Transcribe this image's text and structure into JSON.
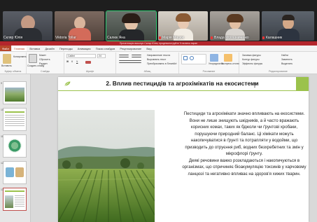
{
  "participants": [
    {
      "name": "Скляр Юлія",
      "muted": false,
      "bg": "#4a4e57"
    },
    {
      "name": "Viktoria Tollar",
      "muted": false,
      "bg": "#6e5a50"
    },
    {
      "name": "Салюк Яна",
      "muted": false,
      "bg": "#58605a",
      "active": true
    },
    {
      "name": "Марія Мацюк",
      "muted": true,
      "bg": "#bfb8ae"
    },
    {
      "name": "Влада Мірошниченко",
      "muted": true,
      "bg": "#8e8a86"
    },
    {
      "name": "Калашник",
      "muted": true,
      "bg": "#50565e"
    }
  ],
  "banner_text": "Презентацію виконує Скляр Юлія, продемонструйте її на весь екран",
  "ribbon": {
    "tabs": [
      "Файл",
      "Главная",
      "Вставка",
      "Дизайн",
      "Переходы",
      "Анимация",
      "Показ слайдов",
      "Рецензирование",
      "Вид"
    ],
    "selected_tab": 1,
    "groups": [
      {
        "label": "Буфер обмена",
        "items": [
          "Вставить",
          "Копировать"
        ]
      },
      {
        "label": "Слайды",
        "items": [
          "Создать слайд",
          "Макет",
          "Сбросить",
          "Раздел"
        ]
      },
      {
        "label": "Шрифт",
        "items": [
          "Calibri",
          "24"
        ]
      },
      {
        "label": "Абзац",
        "items": [
          "Направление текста",
          "Выровнять текст",
          "Преобразовать в SmartArt"
        ]
      },
      {
        "label": "Рисование",
        "items": [
          "Упорядочить",
          "Экспресс-стили"
        ]
      },
      {
        "label": "Редактирование",
        "items": [
          "Заливка фигуры",
          "Контур фигуры",
          "Эффекты фигуры",
          "Найти",
          "Заменить",
          "Выделить"
        ]
      }
    ]
  },
  "thumbnails": [
    "9",
    "10",
    "11",
    "12",
    "13"
  ],
  "slide": {
    "title": "2. Вплив пестицидів та агрохімікатів на екосистеми",
    "paragraphs": [
      "Пестициди та агрохімікати значно впливають на екосистеми. Вони не лише знищують шкідників, а й часто вражають корисних комах, таких як бджоли чи ґрунтові хробаки, порушуючи природний баланс. Ці хімікати можуть накопичуватися в ґрунті та потрапляти у водойми, що призводить до отруєння риб, водних безхребетних та змін у мікрофлорі ґрунту.",
      "Деякі речовини важко розкладаються і накопичуються в організмах, що спричиняє біоакумуляцію токсинів у харчовому ланцюзі та негативно впливає на здоров'я хижих тварин."
    ]
  },
  "colors": {
    "accent": "#9bc24c",
    "banner": "#b3262c",
    "active_tile": "#2ecc71"
  }
}
